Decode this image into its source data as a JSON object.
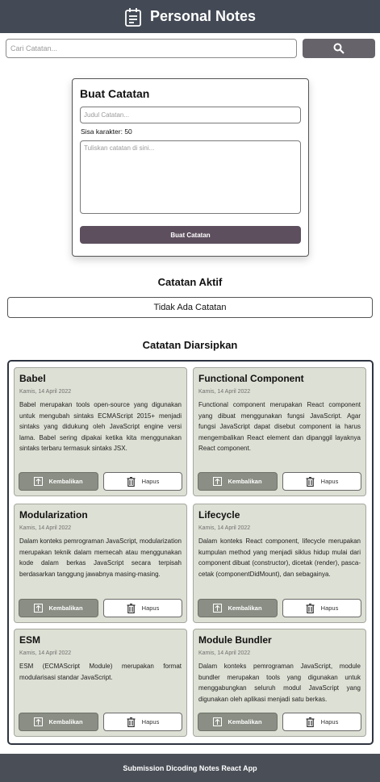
{
  "header": {
    "title": "Personal Notes",
    "logo_icon": "notes-icon"
  },
  "search": {
    "placeholder": "Cari Catatan...",
    "icon": "search-icon"
  },
  "create_form": {
    "heading": "Buat Catatan",
    "title_placeholder": "Judul Catatan...",
    "char_count_label": "Sisa karakter: 50",
    "body_placeholder": "Tuliskan catatan di sini...",
    "submit_label": "Buat Catatan"
  },
  "active": {
    "heading": "Catatan Aktif",
    "empty_message": "Tidak Ada Catatan"
  },
  "archived": {
    "heading": "Catatan Diarsipkan",
    "notes": [
      {
        "title": "Babel",
        "date": "Kamis, 14 April 2022",
        "body": "Babel merupakan tools open-source yang digunakan untuk mengubah sintaks ECMAScript 2015+ menjadi sintaks yang didukung oleh JavaScript engine versi lama. Babel sering dipakai ketika kita menggunakan sintaks terbaru termasuk sintaks JSX.",
        "restore_label": "Kembalikan",
        "delete_label": "Hapus"
      },
      {
        "title": "Functional Component",
        "date": "Kamis, 14 April 2022",
        "body": "Functional component merupakan React component yang dibuat menggunakan fungsi JavaScript. Agar fungsi JavaScript dapat disebut component ia harus mengembalikan React element dan dipanggil layaknya React component.",
        "restore_label": "Kembalikan",
        "delete_label": "Hapus"
      },
      {
        "title": "Modularization",
        "date": "Kamis, 14 April 2022",
        "body": "Dalam konteks pemrograman JavaScript, modularization merupakan teknik dalam memecah atau menggunakan kode dalam berkas JavaScript secara terpisah berdasarkan tanggung jawabnya masing-masing.",
        "restore_label": "Kembalikan",
        "delete_label": "Hapus"
      },
      {
        "title": "Lifecycle",
        "date": "Kamis, 14 April 2022",
        "body": "Dalam konteks React component, lifecycle merupakan kumpulan method yang menjadi siklus hidup mulai dari component dibuat (constructor), dicetak (render), pasca-cetak (componentDidMount), dan sebagainya.",
        "restore_label": "Kembalikan",
        "delete_label": "Hapus"
      },
      {
        "title": "ESM",
        "date": "Kamis, 14 April 2022",
        "body": "ESM (ECMAScript Module) merupakan format modularisasi standar JavaScript.",
        "restore_label": "Kembalikan",
        "delete_label": "Hapus"
      },
      {
        "title": "Module Bundler",
        "date": "Kamis, 14 April 2022",
        "body": "Dalam konteks pemrograman JavaScript, module bundler merupakan tools yang digunakan untuk menggabungkan seluruh modul JavaScript yang digunakan oleh aplikasi menjadi satu berkas.",
        "restore_label": "Kembalikan",
        "delete_label": "Hapus"
      }
    ]
  },
  "footer": {
    "text": "Submission Dicoding Notes React App"
  },
  "colors": {
    "header_bg": "#434a55",
    "search_button_bg": "#67636a",
    "create_button_bg": "#5d4f5e",
    "note_card_bg": "#dde0d4",
    "restore_button_bg": "#8a8e84",
    "footer_bg": "#4a4f57"
  }
}
